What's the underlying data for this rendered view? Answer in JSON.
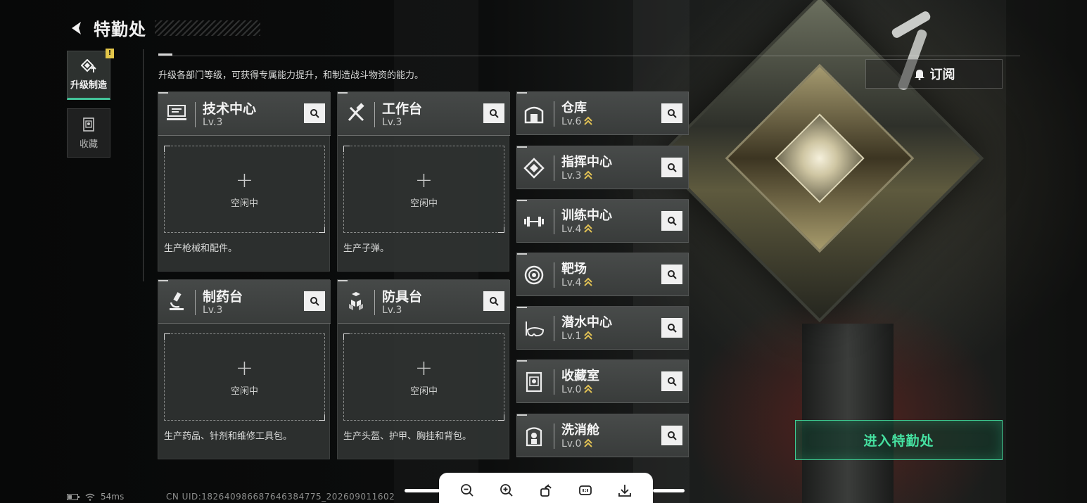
{
  "header": {
    "title": "特勤处"
  },
  "sidebar": {
    "tabs": [
      {
        "label": "升级制造",
        "icon": "upgrade-icon",
        "active": true,
        "badge": "!"
      },
      {
        "label": "收藏",
        "icon": "collection-icon",
        "active": false
      }
    ]
  },
  "description": "升级各部门等级，可获得专属能力提升，和制造战斗物资的能力。",
  "production": [
    {
      "name": "技术中心",
      "level": "Lv.3",
      "icon": "computer-icon",
      "status": "空闲中",
      "desc": "生产枪械和配件。"
    },
    {
      "name": "工作台",
      "level": "Lv.3",
      "icon": "tools-icon",
      "status": "空闲中",
      "desc": "生产子弹。"
    },
    {
      "name": "制药台",
      "level": "Lv.3",
      "icon": "microscope-icon",
      "status": "空闲中",
      "desc": "生产药品、针剂和维修工具包。"
    },
    {
      "name": "防具台",
      "level": "Lv.3",
      "icon": "armor-blocks-icon",
      "status": "空闲中",
      "desc": "生产头盔、护甲、胸挂和背包。"
    }
  ],
  "facilities": [
    {
      "name": "仓库",
      "level": "Lv.6",
      "icon": "warehouse-icon",
      "upgradable": true
    },
    {
      "name": "指挥中心",
      "level": "Lv.3",
      "icon": "command-icon",
      "upgradable": true
    },
    {
      "name": "训练中心",
      "level": "Lv.4",
      "icon": "dumbbell-icon",
      "upgradable": true
    },
    {
      "name": "靶场",
      "level": "Lv.4",
      "icon": "target-icon",
      "upgradable": true
    },
    {
      "name": "潜水中心",
      "level": "Lv.1",
      "icon": "diving-mask-icon",
      "upgradable": true
    },
    {
      "name": "收藏室",
      "level": "Lv.0",
      "icon": "collection-room-icon",
      "upgradable": true
    },
    {
      "name": "洗消舱",
      "level": "Lv.0",
      "icon": "decontamination-icon",
      "upgradable": true
    }
  ],
  "buttons": {
    "subscribe": "订阅",
    "enter": "进入特勤处"
  },
  "status": {
    "ping": "54ms",
    "uid": "CN UID:1826409866876463847​75_202609011602"
  },
  "colors": {
    "accent_green": "#45e0a0",
    "badge_yellow": "#e3c64a",
    "upgrade_gold": "#e2c254"
  }
}
